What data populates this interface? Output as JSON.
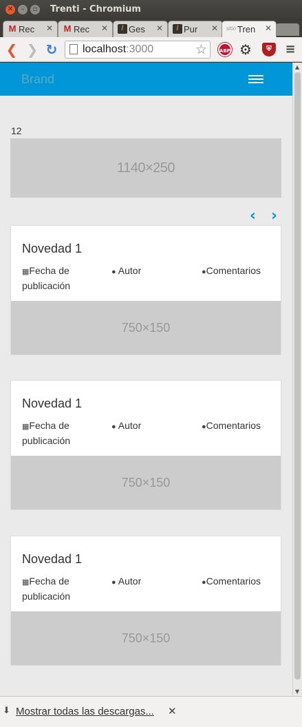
{
  "window": {
    "title": "Trenti - Chromium"
  },
  "tabs": [
    {
      "label": "Rec",
      "favicon": "gmail-icon"
    },
    {
      "label": "Rec",
      "favicon": "gmail-icon"
    },
    {
      "label": "Ges",
      "favicon": "code-icon"
    },
    {
      "label": "Pur",
      "favicon": "code-icon"
    },
    {
      "label": "Tren",
      "favicon": "page-icon",
      "favicon_text": "sitio"
    }
  ],
  "toolbar": {
    "url_host": "localhost",
    "url_port": ":3000"
  },
  "extensions": {
    "abp_label": "ABP"
  },
  "site": {
    "brand": "Brand",
    "section_number": "12",
    "banner_placeholder": "1140×250",
    "accent_color": "#0096d8"
  },
  "posts": [
    {
      "title": "Novedad 1",
      "date_label": "Fecha de publicación",
      "author_label": "Autor",
      "comments_label": "Comentarios",
      "image_placeholder": "750×150"
    },
    {
      "title": "Novedad 1",
      "date_label": "Fecha de publicación",
      "author_label": "Autor",
      "comments_label": "Comentarios",
      "image_placeholder": "750×150"
    },
    {
      "title": "Novedad 1",
      "date_label": "Fecha de publicación",
      "author_label": "Autor",
      "comments_label": "Comentarios",
      "image_placeholder": "750×150"
    }
  ],
  "downloads_bar": {
    "link_label": "Mostrar todas las descargas..."
  }
}
